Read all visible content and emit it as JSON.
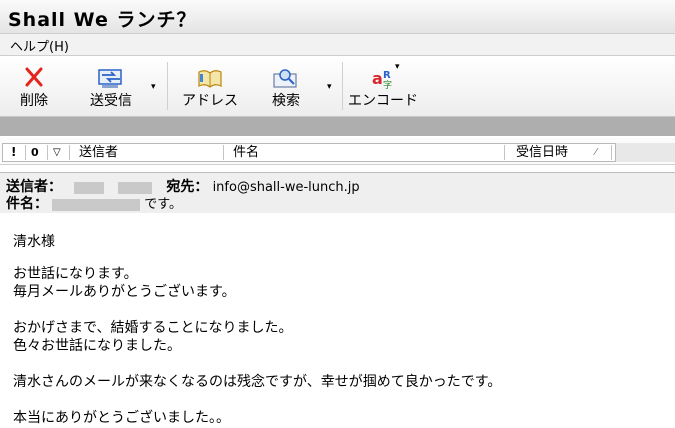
{
  "window": {
    "title": "Shall We ランチ？"
  },
  "menu": {
    "help": "ヘルプ(H)"
  },
  "toolbar": {
    "delete_label": "削除",
    "sendrecv_label": "送受信",
    "address_label": "アドレス",
    "search_label": "検索",
    "encode_label": "エンコード",
    "dropdown_glyph": "▾"
  },
  "list_header": {
    "importance": "!",
    "attachment": "0",
    "flag": "▽",
    "sender": "送信者",
    "subject": "件名",
    "received": "受信日時",
    "sort_glyph": "⁄"
  },
  "mail_header": {
    "sender_label": "送信者：",
    "to_label": "宛先：",
    "to_value": "info@shall-we-lunch.jp",
    "subject_label": "件名：",
    "subject_suffix": "です。"
  },
  "body": {
    "lines": [
      "清水様",
      "お世話になります。",
      "毎月メールありがとうございます。",
      "おかげさまで、結婚することになりました。",
      "色々お世話になりました。",
      "清水さんのメールが来なくなるのは残念ですが、幸せが掴めて良かったです。",
      "本当にありがとうございました。。"
    ]
  },
  "colors": {
    "delete_icon": "#e2261f",
    "accent_blue": "#2a62c9",
    "band_gray": "#aeaeae"
  }
}
